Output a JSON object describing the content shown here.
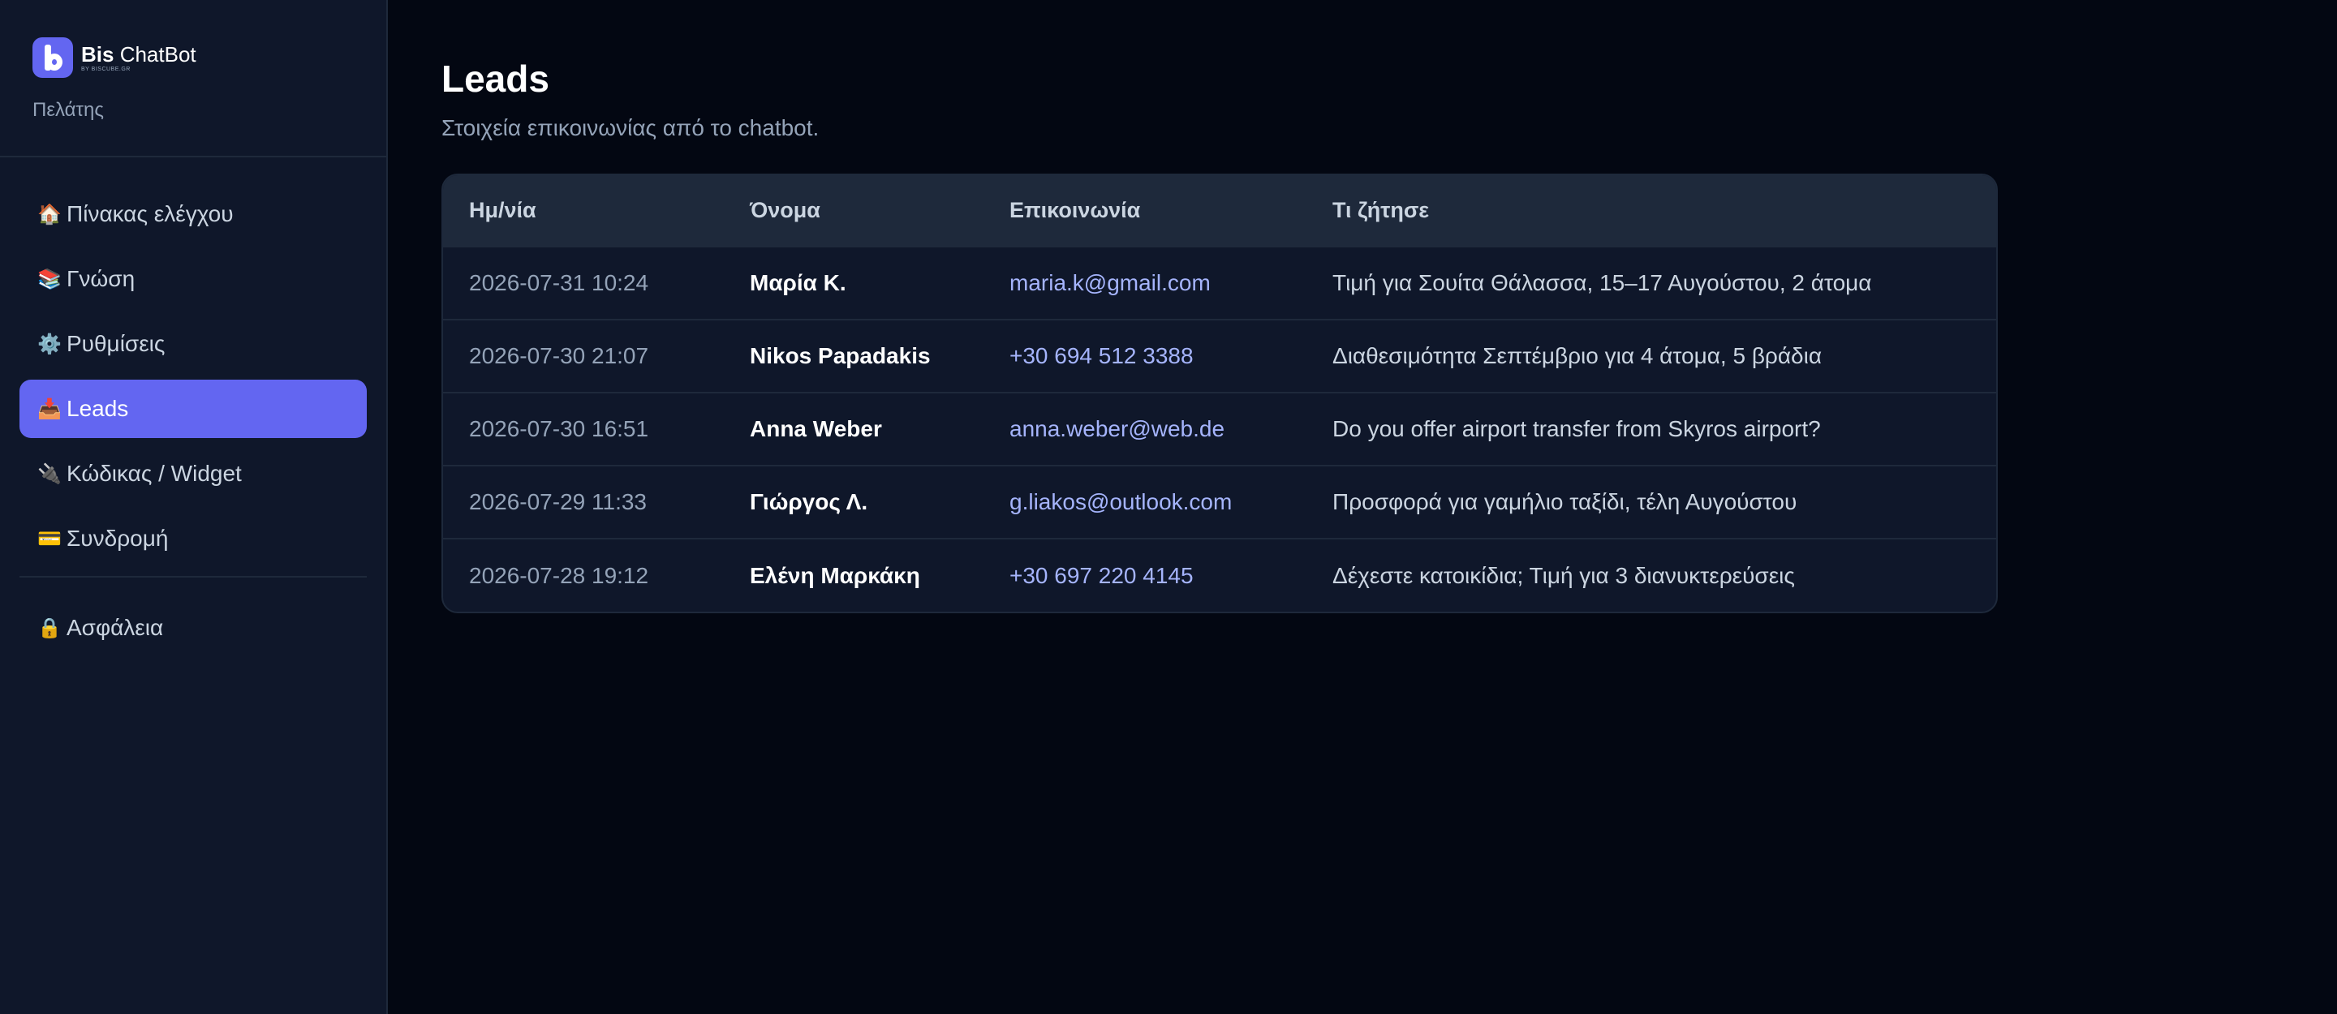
{
  "brand": {
    "name_bold": "Bis",
    "name_rest": " ChatBot",
    "tagline": "BY BISCUBE.GR",
    "role": "Πελάτης"
  },
  "sidebar": {
    "items": [
      {
        "icon": "🏠",
        "icon_name": "house-icon",
        "label": "Πίνακας ελέγχου",
        "active": false
      },
      {
        "icon": "📚",
        "icon_name": "books-icon",
        "label": "Γνώση",
        "active": false
      },
      {
        "icon": "⚙️",
        "icon_name": "gear-icon",
        "label": "Ρυθμίσεις",
        "active": false
      },
      {
        "icon": "📥",
        "icon_name": "inbox-icon",
        "label": "Leads",
        "active": true
      },
      {
        "icon": "🔌",
        "icon_name": "plug-icon",
        "label": "Κώδικας / Widget",
        "active": false
      },
      {
        "icon": "💳",
        "icon_name": "credit-card-icon",
        "label": "Συνδρομή",
        "active": false
      }
    ],
    "footer_items": [
      {
        "icon": "🔒",
        "icon_name": "lock-icon",
        "label": "Ασφάλεια",
        "active": false
      }
    ]
  },
  "main": {
    "title": "Leads",
    "subtitle": "Στοιχεία επικοινωνίας από το chatbot."
  },
  "table": {
    "columns": [
      "Ημ/νία",
      "Όνομα",
      "Επικοινωνία",
      "Τι ζήτησε"
    ],
    "rows": [
      {
        "date": "2026-07-31 10:24",
        "name": "Μαρία Κ.",
        "contact": "maria.k@gmail.com",
        "ask": "Τιμή για Σουίτα Θάλασσα, 15–17 Αυγούστου, 2 άτομα"
      },
      {
        "date": "2026-07-30 21:07",
        "name": "Nikos Papadakis",
        "contact": "+30 694 512 3388",
        "ask": "Διαθεσιμότητα Σεπτέμβριο για 4 άτομα, 5 βράδια"
      },
      {
        "date": "2026-07-30 16:51",
        "name": "Anna Weber",
        "contact": "anna.weber@web.de",
        "ask": "Do you offer airport transfer from Skyros airport?"
      },
      {
        "date": "2026-07-29 11:33",
        "name": "Γιώργος Λ.",
        "contact": "g.liakos@outlook.com",
        "ask": "Προσφορά για γαμήλιο ταξίδι, τέλη Αυγούστου"
      },
      {
        "date": "2026-07-28 19:12",
        "name": "Ελένη Μαρκάκη",
        "contact": "+30 697 220 4145",
        "ask": "Δέχεστε κατοικίδια; Τιμή για 3 διανυκτερεύσεις"
      }
    ]
  },
  "colors": {
    "accent": "#6366f1",
    "sidebar_bg": "#0f172a",
    "page_bg": "#030712",
    "link": "#a5b4fc"
  }
}
